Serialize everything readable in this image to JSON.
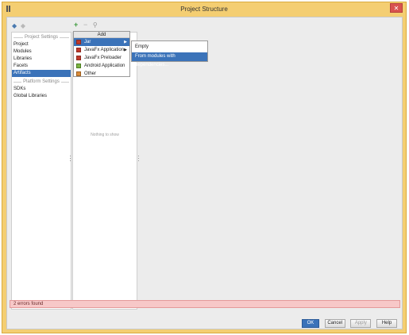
{
  "window": {
    "title": "Project Structure",
    "close_glyph": "✕"
  },
  "toolbar": {
    "back_glyph": "◆",
    "forward_glyph": "◆",
    "add_glyph": "+",
    "remove_glyph": "−",
    "search_glyph": "⚲"
  },
  "sidebar": {
    "project_settings_header": "Project Settings",
    "project_items": [
      {
        "label": "Project"
      },
      {
        "label": "Modules"
      },
      {
        "label": "Libraries"
      },
      {
        "label": "Facets"
      },
      {
        "label": "Artifacts",
        "selected": true
      }
    ],
    "platform_settings_header": "Platform Settings",
    "platform_items": [
      {
        "label": "SDKs"
      },
      {
        "label": "Global Libraries"
      }
    ]
  },
  "artifacts": {
    "empty_text": "Nothing to show"
  },
  "add_menu": {
    "title": "Add",
    "items": [
      {
        "label": "Jar",
        "submenu": true,
        "selected": true,
        "icon": "jar-icon"
      },
      {
        "label": "JavaFx Application",
        "submenu": true,
        "icon": "javafx-icon"
      },
      {
        "label": "JavaFx Preloader",
        "icon": "javafx-icon"
      },
      {
        "label": "Android Application",
        "icon": "android-icon"
      },
      {
        "label": "Other",
        "icon": "other-icon"
      }
    ],
    "submenu_arrow": "▶"
  },
  "jar_submenu": {
    "items": [
      {
        "label": "Empty"
      },
      {
        "label": "From modules with dependencies...",
        "selected": true
      }
    ]
  },
  "status": {
    "error_text": "2 errors found"
  },
  "buttons": {
    "ok": "OK",
    "cancel": "Cancel",
    "apply": "Apply",
    "help": "Help"
  },
  "colors": {
    "window_frame": "#f4ce72",
    "selection": "#3b73b9",
    "error_background": "#f7c8c8"
  }
}
